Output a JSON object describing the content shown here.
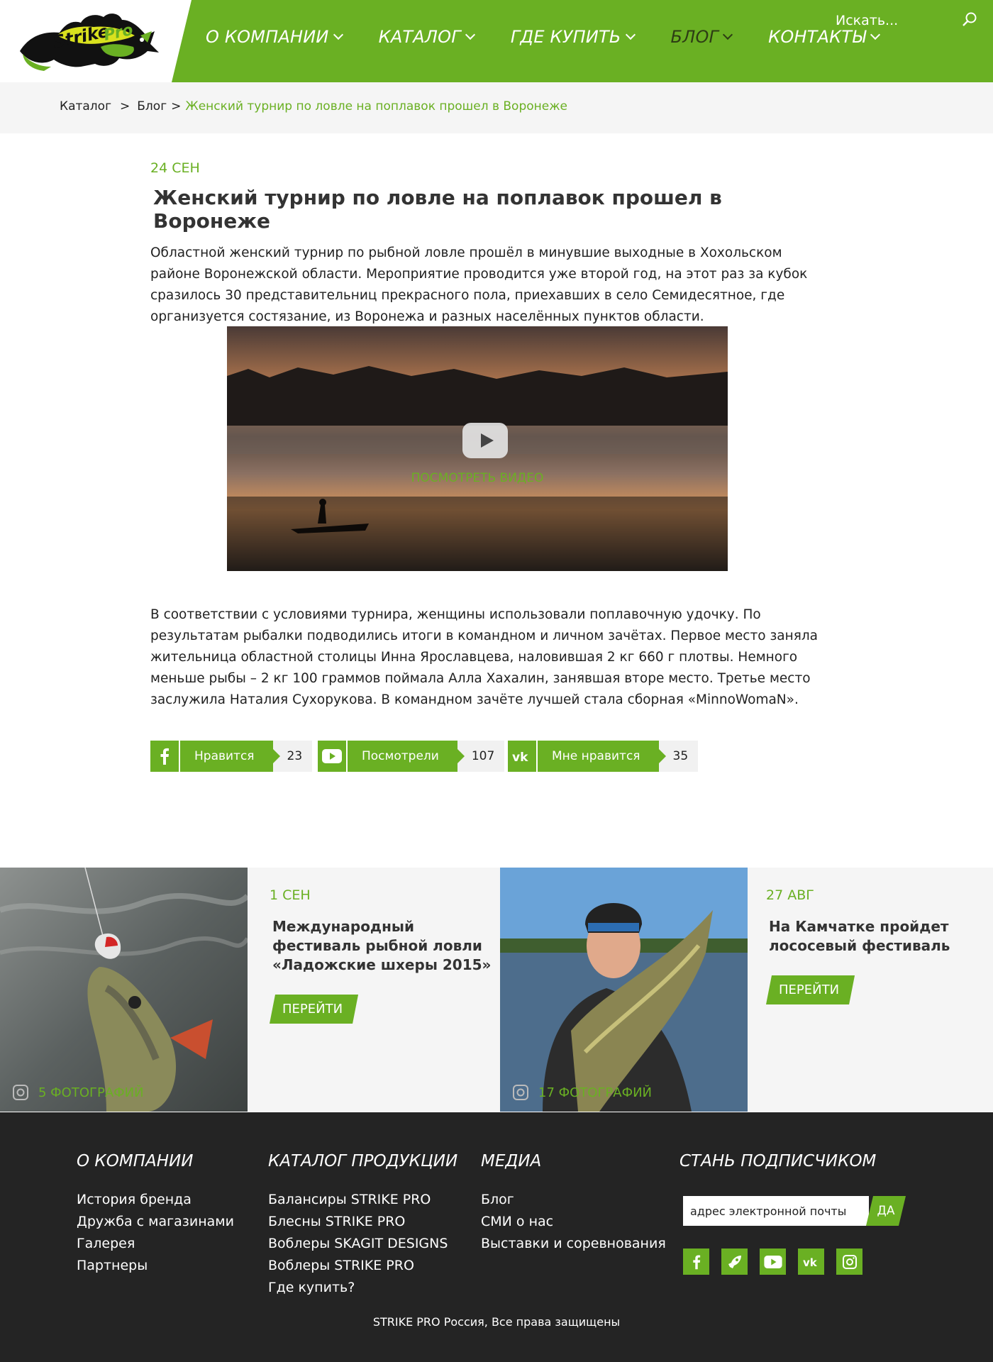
{
  "header": {
    "logo_text": "Strike Pro",
    "nav": [
      {
        "label": "О компании"
      },
      {
        "label": "Каталог"
      },
      {
        "label": "Где купить"
      },
      {
        "label": "Блог"
      },
      {
        "label": "Контакты"
      }
    ],
    "search_placeholder": "Искать..."
  },
  "breadcrumb": {
    "items": [
      "Каталог",
      "Блог"
    ],
    "separator": ">",
    "current": "Женский турнир по ловле на поплавок прошел в Воронеже"
  },
  "article": {
    "date": "24 СЕН",
    "title": "Женский турнир по ловле на поплавок прошел в Воронеже",
    "intro": "Областной женский турнир по рыбной ловле прошёл в минувшие выходные в Хохольском районе Воронежской области. Мероприятие проводится уже второй год, на этот раз за кубок сразилось 30 представительниц прекрасного пола, приехавших в село Семидесятное, где организуется состязание, из Воронежа и разных населённых пунктов области.",
    "video_link": "ПОСМОТРЕТЬ ВИДЕО",
    "body": "В соответствии с условиями турнира, женщины использовали поплавочную удочку. По результатам рыбалки подводились итоги в командном и личном зачётах. Первое место заняла жительница областной столицы Инна Ярославцева, наловившая 2 кг 660 г плотвы. Немного меньше рыбы – 2 кг 100 граммов поймала Алла Хахалин, занявшая вторе место. Третье место заслужила Наталия Сухорукова. В командном зачёте лучшей стала сборная «MinnoWomaN»."
  },
  "social": [
    {
      "icon": "facebook-icon",
      "label": "Нравится",
      "count": "23"
    },
    {
      "icon": "youtube-icon",
      "label": "Посмотрели",
      "count": "107"
    },
    {
      "icon": "vk-icon",
      "label": "Мне нравится",
      "count": "35"
    }
  ],
  "related": [
    {
      "photos": "5 ФОТОГРАФИЙ",
      "date": "1 СЕН",
      "title": "Международный фестиваль рыбной ловли «Ладожские шхеры 2015»",
      "button": "ПЕРЕЙТИ"
    },
    {
      "photos": "17 ФОТОГРАФИЙ",
      "date": "27 АВГ",
      "title": "На Камчатке пройдет лососевый фестиваль",
      "button": "ПЕРЕЙТИ"
    }
  ],
  "footer": {
    "columns": [
      {
        "heading": "О КОМПАНИИ",
        "links": [
          "История бренда",
          "Дружба с магазинами",
          "Галерея",
          "Партнеры"
        ]
      },
      {
        "heading": "КАТАЛОГ ПРОДУКЦИИ",
        "links": [
          "Балансиры STRIKE PRO",
          "Блесны STRIKE PRO",
          "Воблеры SKAGIT DESIGNS",
          "Воблеры STRIKE PRO",
          "Где купить?"
        ]
      },
      {
        "heading": "МЕДИА",
        "links": [
          "Блог",
          "СМИ о нас",
          "Выставки и соревнования"
        ]
      }
    ],
    "subscribe": {
      "heading": "СТАНЬ ПОДПИСЧИКОМ",
      "placeholder": "адрес электронной почты",
      "button": "ДА"
    },
    "social_icons": [
      "facebook-icon",
      "rocket-icon",
      "youtube-icon",
      "vk-icon",
      "instagram-icon"
    ],
    "copyright": "STRIKE PRO Россия, Все права защищены"
  },
  "colors": {
    "accent": "#6ab023",
    "footer_bg": "#242424",
    "light_bg": "#f5f5f5"
  }
}
